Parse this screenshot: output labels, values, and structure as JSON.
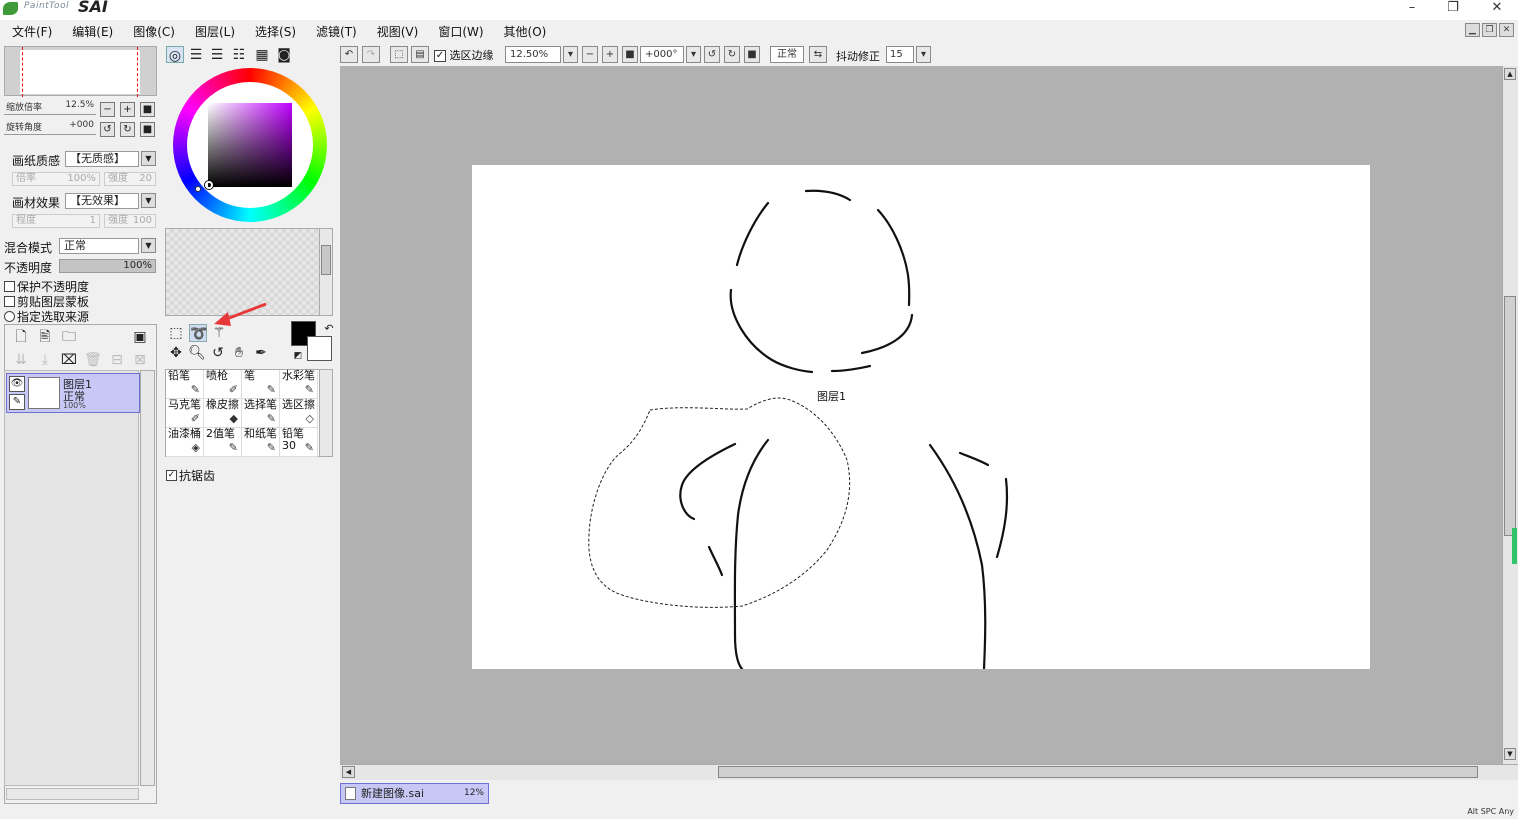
{
  "app": {
    "logo_small": "PaintTool",
    "logo_big": "SAI"
  },
  "window_controls": {
    "minimize": "–",
    "restore": "❐",
    "close": "✕"
  },
  "menu": [
    "文件(F)",
    "编辑(E)",
    "图像(C)",
    "图层(L)",
    "选择(S)",
    "滤镜(T)",
    "视图(V)",
    "窗口(W)",
    "其他(O)"
  ],
  "toolbar": {
    "selection_edge_label": "选区边缘",
    "selection_edge_checked": true,
    "zoom_value": "12.50%",
    "rotation_value": "+000°",
    "mode_value": "正常",
    "stabilizer_label": "抖动修正",
    "stabilizer_value": "15"
  },
  "navigator": {
    "zoom_label": "缩放倍率",
    "zoom_value": "12.5%",
    "rotate_label": "旋转角度",
    "rotate_value": "+000"
  },
  "paper": {
    "texture_label": "画纸质感",
    "texture_value": "【无质感】",
    "texture_scale_label": "倍率",
    "texture_scale_value": "100%",
    "texture_strength_label": "强度",
    "texture_strength_value": "20",
    "effect_label": "画材效果",
    "effect_value": "【无效果】",
    "effect_degree_label": "程度",
    "effect_degree_value": "1",
    "effect_strength_label": "强度",
    "effect_strength_value": "100"
  },
  "layer_props": {
    "blend_label": "混合模式",
    "blend_value": "正常",
    "opacity_label": "不透明度",
    "opacity_value": "100%",
    "opacity_fraction": 1.0,
    "checks": [
      {
        "label": "保护不透明度",
        "checked": false
      },
      {
        "label": "剪贴图层蒙板",
        "checked": false
      },
      {
        "label": "指定选取来源",
        "checked": false
      }
    ]
  },
  "layers": [
    {
      "name": "图层1",
      "mode": "正常",
      "opacity": "100%"
    }
  ],
  "tool_options": {
    "antialias_label": "抗锯齿",
    "antialias_checked": true
  },
  "brushes": [
    {
      "label": "铅笔",
      "icon": "pencil-icon"
    },
    {
      "label": "喷枪",
      "icon": "airbrush-icon"
    },
    {
      "label": "笔",
      "icon": "pen-icon"
    },
    {
      "label": "水彩笔",
      "icon": "watercolor-icon"
    },
    {
      "label": "马克笔",
      "icon": "marker-icon"
    },
    {
      "label": "橡皮擦",
      "icon": "eraser-icon"
    },
    {
      "label": "选择笔",
      "icon": "select-pen-icon"
    },
    {
      "label": "选区擦",
      "icon": "select-eraser-icon"
    },
    {
      "label": "油漆桶",
      "icon": "bucket-icon"
    },
    {
      "label": "2值笔",
      "icon": "binary-pen-icon"
    },
    {
      "label": "和纸笔",
      "icon": "washi-pen-icon"
    },
    {
      "label": "铅笔30",
      "icon": "pencil30-icon"
    }
  ],
  "canvas": {
    "layer_label": "图层1"
  },
  "document_tab": {
    "name": "新建图像.sai",
    "zoom": "12%"
  },
  "statusbar": {
    "text": "Alt SPC Any"
  },
  "colors": {
    "accent_selected": "#c8c8f6",
    "foreground_color": "#000000",
    "background_color": "#ffffff",
    "annotation_arrow": "#e8393a"
  }
}
